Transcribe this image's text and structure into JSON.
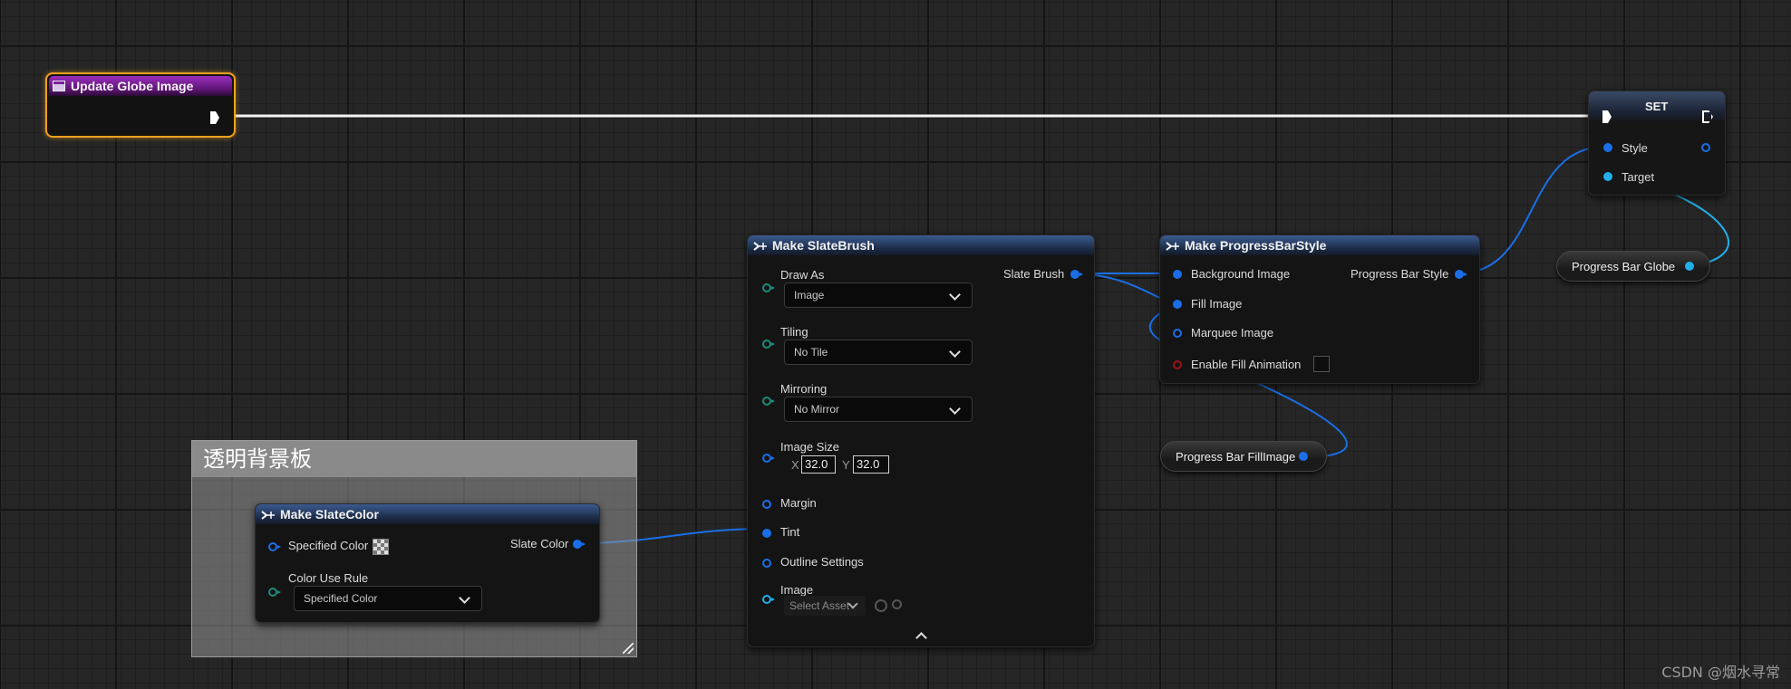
{
  "event_node": {
    "title": "Update Globe Image"
  },
  "set_node": {
    "title": "SET",
    "pins": {
      "style": "Style",
      "target": "Target"
    }
  },
  "make_slate_brush": {
    "title": "Make SlateBrush",
    "draw_as": {
      "label": "Draw As",
      "value": "Image"
    },
    "tiling": {
      "label": "Tiling",
      "value": "No Tile"
    },
    "mirroring": {
      "label": "Mirroring",
      "value": "No Mirror"
    },
    "image_size": {
      "label": "Image Size",
      "x_label": "X",
      "x_value": "32.0",
      "y_label": "Y",
      "y_value": "32.0"
    },
    "margin": "Margin",
    "tint": "Tint",
    "outline_settings": "Outline Settings",
    "image": {
      "label": "Image",
      "select_placeholder": "Select Asset"
    },
    "output": "Slate Brush"
  },
  "make_progressbar_style": {
    "title": "Make ProgressBarStyle",
    "background_image": "Background Image",
    "fill_image": "Fill Image",
    "marquee_image": "Marquee Image",
    "enable_fill_animation": "Enable Fill Animation",
    "output": "Progress Bar Style"
  },
  "var_progress_bar_globe": {
    "label": "Progress Bar Globe"
  },
  "var_progress_bar_fillmage": {
    "label": "Progress Bar FillImage"
  },
  "comment_box": {
    "title": "透明背景板"
  },
  "make_slate_color": {
    "title": "Make SlateColor",
    "specified_color": "Specified Color",
    "color_use_rule": {
      "label": "Color Use Rule",
      "value": "Specified Color"
    },
    "output": "Slate Color"
  },
  "watermark": "CSDN @烟水寻常",
  "colors": {
    "pin_blue": "#1a6fe8",
    "pin_teal": "#1f8c7c",
    "pin_red": "#9e1414",
    "event_purple": "#7b1f9a",
    "selection_orange": "#f0a020",
    "func_header_blue": "#2e4b7c"
  }
}
